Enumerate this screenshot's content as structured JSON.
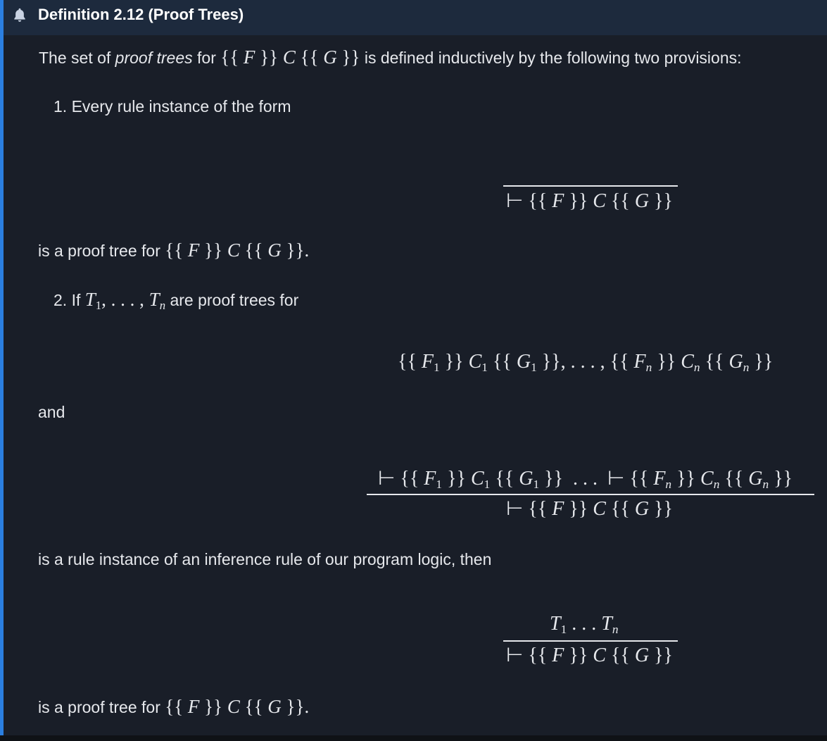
{
  "callout": {
    "icon": "bell-icon",
    "title": "Definition 2.12 (Proof Trees)",
    "accent_color": "#2b7fe0",
    "header_bg": "#1d2a3d",
    "body_bg": "#191e28"
  },
  "intro": {
    "prefix": "The set of ",
    "emph": "proof trees",
    "mid": " for ",
    "suffix": " is defined inductively by the following two provisions:"
  },
  "item1": {
    "label": "1. Every rule instance of the form",
    "after": "is a proof tree for"
  },
  "item2": {
    "label_prefix": "2. If",
    "label_suffix": "are proof trees for",
    "and": "and",
    "after_rule": "is a rule instance of an inference rule of our program logic, then",
    "final": "is a proof tree for"
  }
}
